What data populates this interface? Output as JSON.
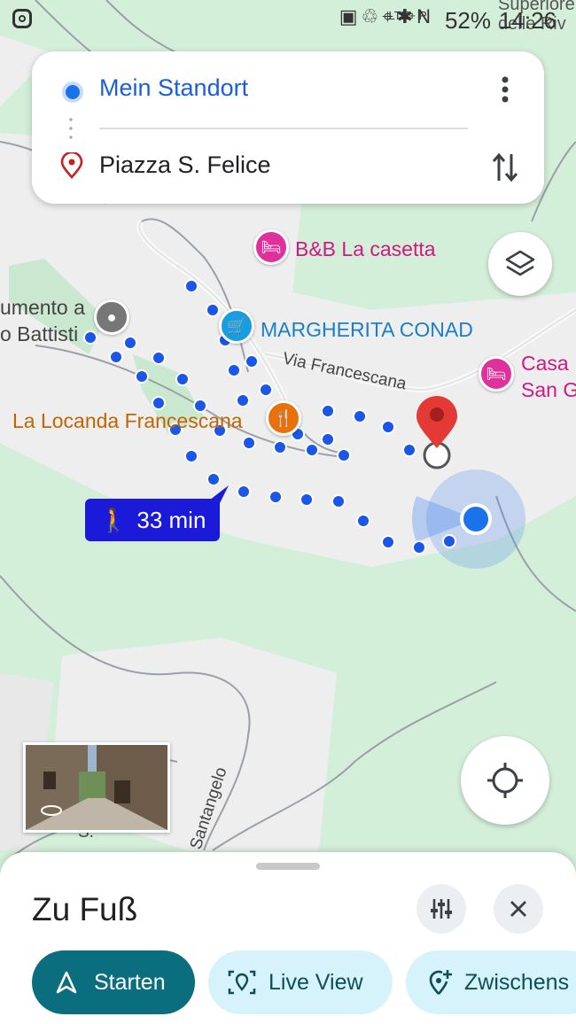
{
  "status_bar": {
    "time": "14:26",
    "battery": "52%",
    "network": "LTE+ R",
    "corner_text_1": "Superiore C",
    "corner_text_2": "delle Riv"
  },
  "route": {
    "origin": "Mein Standort",
    "destination": "Piazza S. Felice"
  },
  "map": {
    "street_via_francescana": "Via Francescana",
    "street_santangelo": "Santangelo",
    "street_s": "S.",
    "places": [
      {
        "name": "B&B La casetta",
        "color": "#e0309b",
        "icon": "bed-icon"
      },
      {
        "name": "MARGHERITA CONAD",
        "color": "#1a9de0",
        "icon": "shopping-cart-icon"
      },
      {
        "name": "Casa",
        "color": "#e0309b",
        "icon": "bed-icon"
      },
      {
        "name": "San G",
        "color": "#e0309b"
      },
      {
        "name": "La Locanda Francescana",
        "color": "#e8710a",
        "icon": "restaurant-icon"
      },
      {
        "name": "umento a",
        "color": "#555555",
        "icon": "monument-pin-icon"
      },
      {
        "name": "o Battisti",
        "color": "#555555"
      }
    ],
    "walk_time": "33 min",
    "route_color": "#1a56e8",
    "destination_pin_color": "#e53935"
  },
  "sheet": {
    "title": "Zu Fuß",
    "buttons": {
      "start": "Starten",
      "live_view": "Live View",
      "stops": "Zwischens"
    },
    "start_color": "#0b6e7f",
    "chip_color": "#d6f3fb"
  }
}
